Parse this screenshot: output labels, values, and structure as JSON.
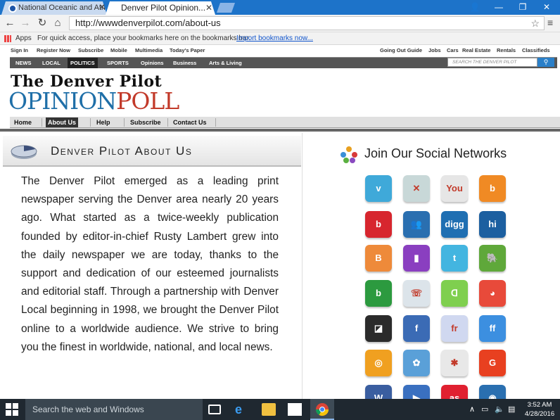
{
  "browser": {
    "tabs": [
      {
        "title": "National Oceanic and Atmo"
      },
      {
        "title": "Denver Pilot Opinion..."
      }
    ],
    "window_controls": {
      "user": "👤",
      "minimize": "—",
      "restore": "❐",
      "close": "✕"
    },
    "url": "http://wwwdenverpilot.com/about-us",
    "bookmarks_bar": {
      "apps_label": "Apps",
      "message": "For quick access, place your bookmarks here on the bookmarks bar.",
      "import_link": "Import bookmarks now..."
    }
  },
  "site": {
    "utility_left": [
      "Sign In",
      "Register Now",
      "Subscribe",
      "Mobile",
      "Multimedia",
      "Today's Paper"
    ],
    "utility_right": [
      "Going Out Guide",
      "Jobs",
      "Cars",
      "Real Estate",
      "Rentals",
      "Classifieds"
    ],
    "section_nav": [
      "NEWS",
      "LOCAL",
      "POLITICS",
      "SPORTS",
      "Opinions",
      "Business",
      "Arts & Living"
    ],
    "search_placeholder": "SEARCH THE DENVER PILOT",
    "logo_top": "The Denver Pilot",
    "logo_opinion": "OPINION",
    "logo_poll": "POLL",
    "main_nav": [
      "Home",
      "About Us",
      "Help",
      "Subscribe",
      "Contact Us"
    ],
    "active_main_nav": "About Us"
  },
  "about": {
    "title": "Denver Pilot About Us",
    "body": "The Denver Pilot emerged as a leading print newspaper serving the Denver area nearly 20 years ago. What started as a twice-weekly publication founded by editor-in-chief Rusty Lambert grew into the daily newspaper we are today, thanks to the support and dedication of our esteemed journalists and editorial staff. Through a partnership with Denver Local beginning in 1998, we brought the Denver Pilot online to a worldwide audience. We strive to bring you the finest in worldwide, national, and local news."
  },
  "social": {
    "title": "Join Our Social Networks",
    "icons": [
      {
        "name": "vimeo-icon",
        "glyph": "v",
        "color": "#3fa9d9"
      },
      {
        "name": "xing-icon",
        "glyph": "✕",
        "color": "#c8d8d8"
      },
      {
        "name": "youtube-icon",
        "glyph": "You",
        "color": "#e6e6e6"
      },
      {
        "name": "blogger-icon",
        "glyph": "b",
        "color": "#f08a24"
      },
      {
        "name": "beats-icon",
        "glyph": "b",
        "color": "#d7262e"
      },
      {
        "name": "myspace-icon",
        "glyph": "👥",
        "color": "#2a6fb0"
      },
      {
        "name": "digg-icon",
        "glyph": "digg",
        "color": "#1f6fb2"
      },
      {
        "name": "hi5-icon",
        "glyph": "hi",
        "color": "#1c5fa0"
      },
      {
        "name": "blogger-alt-icon",
        "glyph": "B",
        "color": "#ee8a3a"
      },
      {
        "name": "rainbow-icon",
        "glyph": "▮",
        "color": "#8a3fc0"
      },
      {
        "name": "twitter-icon",
        "glyph": "t",
        "color": "#43b5e0"
      },
      {
        "name": "evernote-icon",
        "glyph": "🐘",
        "color": "#5fa83a"
      },
      {
        "name": "bebo-icon",
        "glyph": "b",
        "color": "#2c9a3f"
      },
      {
        "name": "skype-icon",
        "glyph": "☏",
        "color": "#dce4ea"
      },
      {
        "name": "delicious-green-icon",
        "glyph": "ᗡ",
        "color": "#7fcf4f"
      },
      {
        "name": "google-icon",
        "glyph": "◕",
        "color": "#e84a3a"
      },
      {
        "name": "delicious-icon",
        "glyph": "◪",
        "color": "#2b2b2b"
      },
      {
        "name": "facebook-icon",
        "glyph": "f",
        "color": "#3b6bb5"
      },
      {
        "name": "friendfeed-icon",
        "glyph": "fr",
        "color": "#d0d8f0"
      },
      {
        "name": "friendfeed-blue-icon",
        "glyph": "ff",
        "color": "#3c8fe0"
      },
      {
        "name": "lifesaver-icon",
        "glyph": "◎",
        "color": "#f0a020"
      },
      {
        "name": "ribbon-icon",
        "glyph": "✿",
        "color": "#5aa0d8"
      },
      {
        "name": "yelp-icon",
        "glyph": "✱",
        "color": "#e8e8e8"
      },
      {
        "name": "grooveshark-icon",
        "glyph": "G",
        "color": "#e84020"
      },
      {
        "name": "vk-icon",
        "glyph": "W",
        "color": "#3a5ea0"
      },
      {
        "name": "play-icon",
        "glyph": "▶",
        "color": "#3a70c0"
      },
      {
        "name": "lastfm-icon",
        "glyph": "as",
        "color": "#e02030"
      },
      {
        "name": "globe-icon",
        "glyph": "◉",
        "color": "#2a6fb0"
      }
    ]
  },
  "taskbar": {
    "search_placeholder": "Search the web and Windows",
    "time": "3:52 AM",
    "date": "4/28/2016"
  }
}
